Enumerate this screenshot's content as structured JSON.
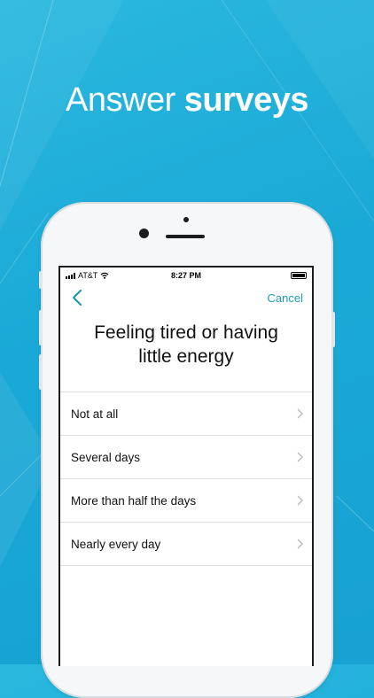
{
  "headline": {
    "light": "Answer",
    "bold": "surveys"
  },
  "status_bar": {
    "carrier": "AT&T",
    "time": "8:27 PM"
  },
  "nav": {
    "cancel_label": "Cancel"
  },
  "question": "Feeling tired or having little energy",
  "options": [
    "Not at all",
    "Several days",
    "More than half the days",
    "Nearly every day"
  ],
  "colors": {
    "background": "#1aa9d6",
    "accent": "#1d9bb0"
  },
  "icons": {
    "back": "chevron-left-icon",
    "option": "chevron-right-icon",
    "wifi": "wifi-icon",
    "signal": "signal-bars-icon",
    "battery": "battery-icon"
  }
}
